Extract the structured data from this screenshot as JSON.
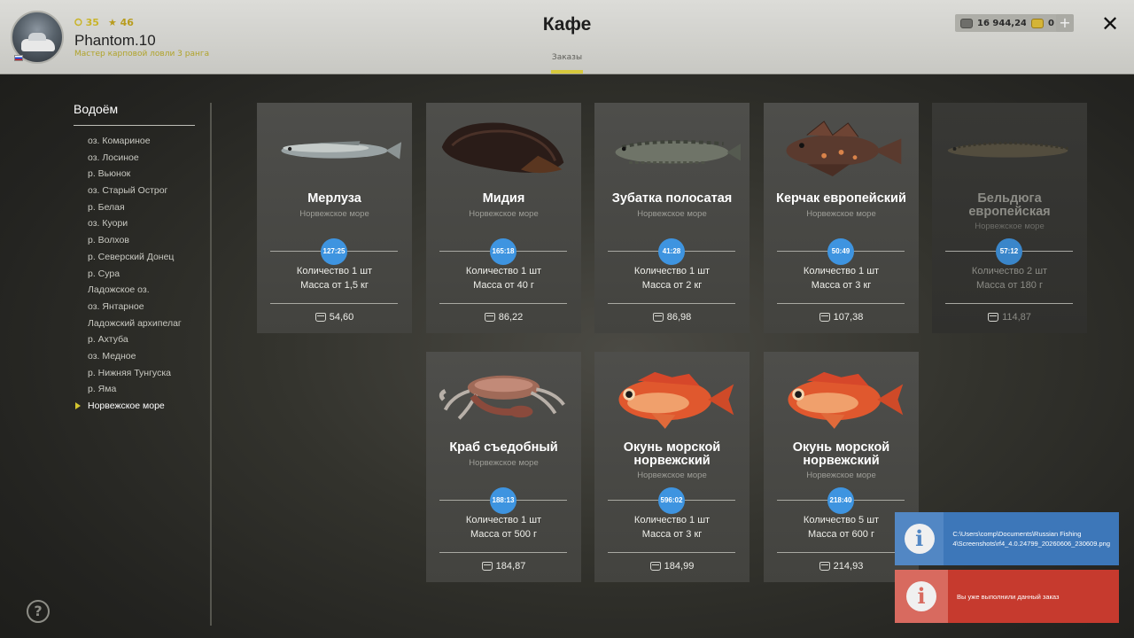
{
  "header": {
    "title": "Кафе",
    "tab_orders": "Заказы",
    "username": "Phantom.10",
    "user_title": "Мастер карповой ловли 3 ранга",
    "level": "35",
    "rank": "46",
    "silver_amount": "16 944,24",
    "gold_amount": "0",
    "plus_label": "+",
    "close_label": "✕"
  },
  "sidebar": {
    "title": "Водоём",
    "items": [
      {
        "label": "оз. Комариное"
      },
      {
        "label": "оз. Лосиное"
      },
      {
        "label": "р. Вьюнок"
      },
      {
        "label": "оз. Старый Острог"
      },
      {
        "label": "р. Белая"
      },
      {
        "label": "оз. Куори"
      },
      {
        "label": "р. Волхов"
      },
      {
        "label": "р. Северский Донец"
      },
      {
        "label": "р. Сура"
      },
      {
        "label": "Ладожское оз."
      },
      {
        "label": "оз. Янтарное"
      },
      {
        "label": "Ладожский архипелаг"
      },
      {
        "label": "р. Ахтуба"
      },
      {
        "label": "оз. Медное"
      },
      {
        "label": "р. Нижняя Тунгуска"
      },
      {
        "label": "р. Яма"
      },
      {
        "label": "Норвежское море"
      }
    ],
    "active_index": 16
  },
  "orders": [
    {
      "name": "Мерлуза",
      "location": "Норвежское море",
      "timer": "127:25",
      "quantity": "Количество 1 шт",
      "mass": "Масса от 1,5 кг",
      "price": "54,60",
      "icon": "hake-fish-icon"
    },
    {
      "name": "Мидия",
      "location": "Норвежское море",
      "timer": "165:18",
      "quantity": "Количество 1 шт",
      "mass": "Масса от 40 г",
      "price": "86,22",
      "icon": "mussel-icon"
    },
    {
      "name": "Зубатка полосатая",
      "location": "Норвежское море",
      "timer": "41:28",
      "quantity": "Количество 1 шт",
      "mass": "Масса от 2 кг",
      "price": "86,98",
      "icon": "wolffish-icon"
    },
    {
      "name": "Керчак европейский",
      "location": "Норвежское море",
      "timer": "50:49",
      "quantity": "Количество 1 шт",
      "mass": "Масса от 3 кг",
      "price": "107,38",
      "icon": "sculpin-icon"
    },
    {
      "name": "Бельдюга европейская",
      "location": "Норвежское море",
      "timer": "57:12",
      "quantity": "Количество 2 шт",
      "mass": "Масса от 180 г",
      "price": "114,87",
      "icon": "eelpout-icon",
      "disabled": true
    },
    {
      "name": "Краб съедобный",
      "location": "Норвежское море",
      "timer": "188:13",
      "quantity": "Количество 1 шт",
      "mass": "Масса от 500 г",
      "price": "184,87",
      "icon": "crab-icon"
    },
    {
      "name": "Окунь морской норвежский",
      "location": "Норвежское море",
      "timer": "596:02",
      "quantity": "Количество 1 шт",
      "mass": "Масса от 3 кг",
      "price": "184,99",
      "icon": "redfish-icon"
    },
    {
      "name": "Окунь морской норвежский",
      "location": "Норвежское море",
      "timer": "218:40",
      "quantity": "Количество 5 шт",
      "mass": "Масса от 600 г",
      "price": "214,93",
      "icon": "redfish-icon"
    }
  ],
  "notifications": {
    "info_text": "C:\\Users\\comp\\Documents\\Russian Fishing 4\\Screenshots\\rf4_4.0.24799_20260606_230609.png",
    "error_text": "Вы уже выполнили данный заказ",
    "icon_glyph": "i"
  },
  "help_glyph": "?",
  "colors": {
    "accent": "#d7c83c",
    "timer": "#3e94e0",
    "info": "#3d77b9",
    "error": "#c63a2e"
  }
}
